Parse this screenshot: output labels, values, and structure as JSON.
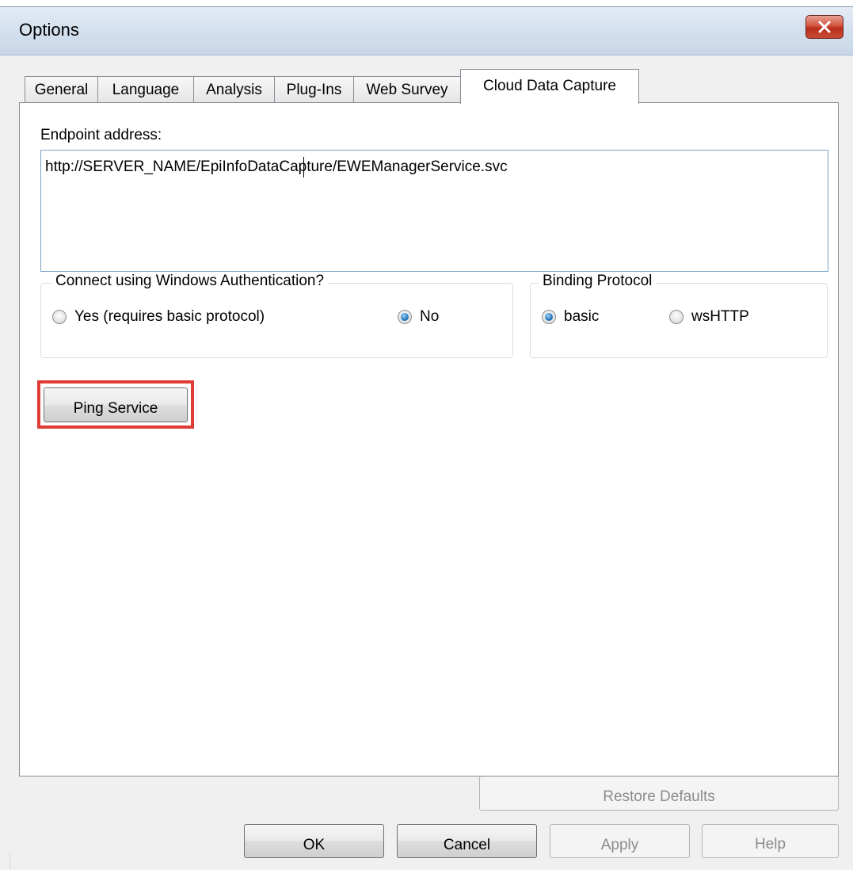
{
  "window": {
    "title": "Options"
  },
  "tabs": [
    {
      "label": "General",
      "active": false
    },
    {
      "label": "Language",
      "active": false
    },
    {
      "label": "Analysis",
      "active": false
    },
    {
      "label": "Plug-Ins",
      "active": false
    },
    {
      "label": "Web Survey",
      "active": false
    },
    {
      "label": "Cloud Data Capture",
      "active": true
    }
  ],
  "cloud": {
    "endpoint_label": "Endpoint address:",
    "endpoint_value": "http://SERVER_NAME/EpiInfoDataCapture/EWEManagerService.svc",
    "auth_group": {
      "caption": "Connect using Windows Authentication?",
      "options": [
        {
          "label": "Yes (requires basic protocol)",
          "checked": false
        },
        {
          "label": "No",
          "checked": true
        }
      ]
    },
    "binding_group": {
      "caption": "Binding Protocol",
      "options": [
        {
          "label": "basic",
          "checked": true
        },
        {
          "label": "wsHTTP",
          "checked": false
        }
      ]
    },
    "ping_label": "Ping Service",
    "highlight_color": "#e03c36"
  },
  "footer": {
    "restore_label": "Restore Defaults",
    "ok_label": "OK",
    "cancel_label": "Cancel",
    "apply_label": "Apply",
    "help_label": "Help"
  },
  "icons": {
    "close": "close-icon"
  }
}
